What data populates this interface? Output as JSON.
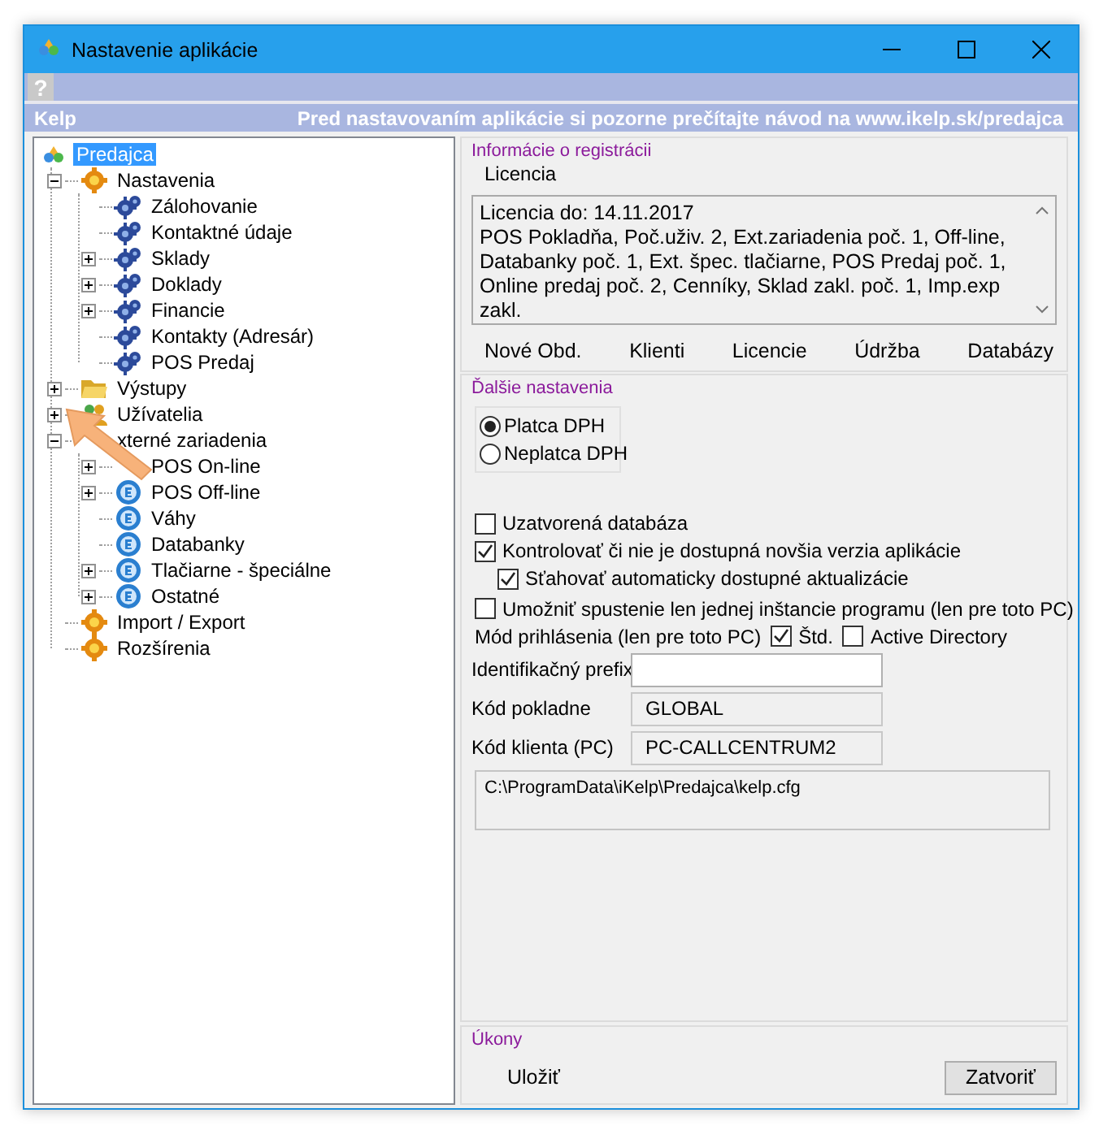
{
  "window": {
    "title": "Nastavenie aplikácie",
    "help": "?"
  },
  "header": {
    "app_name": "Kelp",
    "notice": "Pred nastavovaním aplikácie si pozorne prečítajte návod na www.ikelp.sk/predajca"
  },
  "tree": [
    {
      "label": "Predajca",
      "kind": "app",
      "selected": true,
      "children": [
        {
          "label": "Nastavenia",
          "kind": "cog",
          "expanded": true,
          "selected": false,
          "children": [
            {
              "label": "Zálohovanie",
              "kind": "gear",
              "selected": false
            },
            {
              "label": "Kontaktné údaje",
              "kind": "gear",
              "selected": false
            },
            {
              "label": "Sklady",
              "kind": "gear",
              "expanded": false,
              "selected": false
            },
            {
              "label": "Doklady",
              "kind": "gear",
              "expanded": false,
              "selected": false
            },
            {
              "label": "Financie",
              "kind": "gear",
              "expanded": false,
              "selected": false
            },
            {
              "label": "Kontakty (Adresár)",
              "kind": "gear",
              "selected": false
            },
            {
              "label": "POS Predaj",
              "kind": "gear",
              "selected": false
            }
          ]
        },
        {
          "label": "Výstupy",
          "kind": "folder",
          "expanded": false,
          "selected": false
        },
        {
          "label": "Užívatelia",
          "kind": "users",
          "expanded": false,
          "selected": false
        },
        {
          "label": "xterné zariadenia",
          "kind": "hidden",
          "expanded": true,
          "selected": false,
          "children": [
            {
              "label": "POS On-line",
              "kind": "hidden",
              "expanded": false,
              "selected": false
            },
            {
              "label": "POS Off-line",
              "kind": "device",
              "expanded": false,
              "selected": false
            },
            {
              "label": "Váhy",
              "kind": "device",
              "selected": false
            },
            {
              "label": "Databanky",
              "kind": "device",
              "selected": false
            },
            {
              "label": "Tlačiarne - špeciálne",
              "kind": "device",
              "expanded": false,
              "selected": false
            },
            {
              "label": "Ostatné",
              "kind": "device",
              "expanded": false,
              "selected": false
            }
          ]
        },
        {
          "label": "Import / Export",
          "kind": "cog",
          "selected": false
        },
        {
          "label": "Rozšírenia",
          "kind": "cog",
          "selected": false
        }
      ]
    }
  ],
  "registration": {
    "title": "Informácie o registrácii",
    "label": "Licencia",
    "license_lines": [
      "Licencia do: 14.11.2017",
      "POS Pokladňa, Poč.uživ. 2, Ext.zariadenia poč. 1, Off-line,",
      "Databanky poč. 1, Ext. špec. tlačiarne, POS Predaj poč. 1,",
      "Online predaj poč. 2, Cenníky, Sklad zakl. poč. 1, Imp.exp",
      "zakl."
    ],
    "buttons": [
      "Nové Obd.",
      "Klienti",
      "Licencie",
      "Údržba",
      "Databázy"
    ]
  },
  "more_settings": {
    "title": "Ďalšie nastavenia",
    "vat": [
      {
        "label": "Platca DPH",
        "selected": true
      },
      {
        "label": "Neplatca DPH",
        "selected": false
      }
    ],
    "options": [
      {
        "label": "Uzatvorená databáza",
        "checked": false
      },
      {
        "label": "Kontrolovať či nie je dostupná novšia verzia aplikácie",
        "checked": true,
        "children": [
          {
            "label": "Sťahovať automaticky dostupné aktualizácie",
            "checked": true
          }
        ]
      },
      {
        "label": "Umožniť spustenie len jednej inštancie programu (len pre toto PC)",
        "checked": false
      }
    ],
    "login_mode": {
      "label": "Mód prihlásenia (len pre toto PC)",
      "options": [
        {
          "label": "Štd.",
          "checked": true
        },
        {
          "label": "Active Directory",
          "checked": false
        }
      ]
    },
    "fields": [
      {
        "label": "Identifikačný prefix",
        "readonly": false
      },
      {
        "label": "Kód pokladne",
        "value": "GLOBAL",
        "readonly": true
      },
      {
        "label": "Kód klienta (PC)",
        "value": "PC-CALLCENTRUM2",
        "readonly": true
      }
    ],
    "config_path": "C:\\ProgramData\\iKelp\\Predajca\\kelp.cfg"
  },
  "actions": {
    "title": "Úkony",
    "buttons": [
      {
        "label": "Uložiť",
        "kind": "flat"
      },
      {
        "label": "Zatvoriť",
        "kind": "raised"
      }
    ]
  }
}
